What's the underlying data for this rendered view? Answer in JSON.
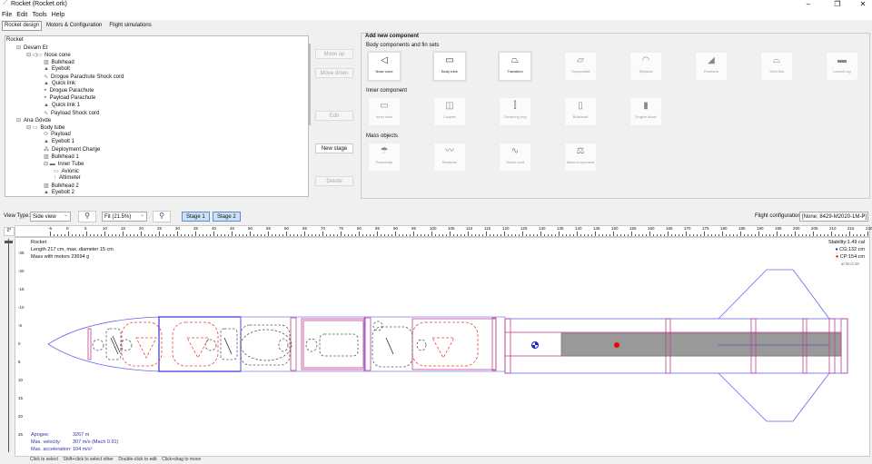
{
  "window": {
    "title": "Rocket (Rocket.ork)",
    "minimize": "–",
    "maximize": "❐",
    "close": "✕"
  },
  "menu": [
    "File",
    "Edit",
    "Tools",
    "Help"
  ],
  "tabs": [
    "Rocket design",
    "Motors & Configuration",
    "Flight simulations"
  ],
  "tree": [
    {
      "label": "Rocket",
      "depth": 0,
      "icon": ""
    },
    {
      "label": "Devam Et",
      "depth": 1,
      "icon": "⊟"
    },
    {
      "label": "Nose cone",
      "depth": 2,
      "icon": "⊟ ◁▭"
    },
    {
      "label": "Bulkhead",
      "depth": 3,
      "icon": "▥"
    },
    {
      "label": "Eyebolt",
      "depth": 3,
      "icon": "▲"
    },
    {
      "label": "Drogue Parachute Shock cord",
      "depth": 3,
      "icon": "∿"
    },
    {
      "label": "Quick link",
      "depth": 3,
      "icon": "▲"
    },
    {
      "label": "Drogue Parachute",
      "depth": 3,
      "icon": "◓"
    },
    {
      "label": "Payload Parachute",
      "depth": 3,
      "icon": "◓"
    },
    {
      "label": "Quick link 1",
      "depth": 3,
      "icon": "▲"
    },
    {
      "label": "Payload Shock cord",
      "depth": 3,
      "icon": "∿"
    },
    {
      "label": "Ana Gövde",
      "depth": 1,
      "icon": "⊟"
    },
    {
      "label": "Body tube",
      "depth": 2,
      "icon": "⊟ ▭"
    },
    {
      "label": "Payload",
      "depth": 3,
      "icon": "⬭"
    },
    {
      "label": "Eyebolt 1",
      "depth": 3,
      "icon": "▲"
    },
    {
      "label": "Deployment Charge",
      "depth": 3,
      "icon": "⁂"
    },
    {
      "label": "Bulkhead 1",
      "depth": 3,
      "icon": "▥"
    },
    {
      "label": "Inner Tube",
      "depth": 3,
      "icon": "⊟ ▬"
    },
    {
      "label": "Avionic",
      "depth": 4,
      "icon": "▭"
    },
    {
      "label": "Altimeter",
      "depth": 4,
      "icon": "↑"
    },
    {
      "label": "Bulkhead 2",
      "depth": 3,
      "icon": "▥"
    },
    {
      "label": "Eyebolt 2",
      "depth": 3,
      "icon": "▲"
    }
  ],
  "buttons": {
    "move_up": "Move up",
    "move_down": "Move down",
    "edit": "Edit",
    "new_stage": "New stage",
    "delete": "Delete"
  },
  "add": {
    "title": "Add new component",
    "sections": [
      {
        "label": "Body components and fin sets",
        "items": [
          {
            "label": "Nose cone",
            "icon": "◁",
            "en": true
          },
          {
            "label": "Body tube",
            "icon": "▭",
            "en": true
          },
          {
            "label": "Transition",
            "icon": "⏢",
            "en": true
          },
          {
            "label": "Trapezoidal",
            "icon": "⏥",
            "en": false
          },
          {
            "label": "Elliptical",
            "icon": "◠",
            "en": false
          },
          {
            "label": "Freeform",
            "icon": "◢",
            "en": false
          },
          {
            "label": "Tube fins",
            "icon": "⌓",
            "en": false
          },
          {
            "label": "Launch lug",
            "icon": "▬",
            "en": false
          }
        ]
      },
      {
        "label": "Inner component",
        "items": [
          {
            "label": "Inner tube",
            "icon": "▭",
            "en": false
          },
          {
            "label": "Coupler",
            "icon": "◫",
            "en": false
          },
          {
            "label": "Centering ring",
            "icon": "⫿",
            "en": false
          },
          {
            "label": "Bulkhead",
            "icon": "▯",
            "en": false
          },
          {
            "label": "Engine block",
            "icon": "▮",
            "en": false
          }
        ]
      },
      {
        "label": "Mass objects",
        "items": [
          {
            "label": "Parachute",
            "icon": "☂",
            "en": false
          },
          {
            "label": "Streamer",
            "icon": "〰",
            "en": false
          },
          {
            "label": "Shock cord",
            "icon": "∿",
            "en": false
          },
          {
            "label": "Mass component",
            "icon": "⚖",
            "en": false
          }
        ]
      }
    ]
  },
  "view": {
    "type_label": "View Type:",
    "type_value": "Side view",
    "zoom_value": "Fit (21.5%)",
    "stages": [
      "Stage 1",
      "Stage 2"
    ],
    "config_label": "Flight configuration:",
    "config_value": "[None; 8429-M2020-1M-P]",
    "rotation": "0°"
  },
  "ruler_h": [
    -5,
    0,
    5,
    10,
    15,
    20,
    25,
    30,
    35,
    40,
    45,
    50,
    55,
    60,
    65,
    70,
    75,
    80,
    85,
    90,
    95,
    100,
    105,
    110,
    115,
    120,
    125,
    130,
    135,
    140,
    145,
    150,
    155,
    160,
    165,
    170,
    175,
    180,
    185,
    190,
    195,
    200,
    205,
    210,
    215,
    220
  ],
  "ruler_v": [
    -25,
    -20,
    -15,
    -10,
    -5,
    0,
    5,
    10,
    15,
    20,
    25
  ],
  "rocket": {
    "name": "Rocket",
    "length": "Length 217 cm, max. diameter 15 cm",
    "mass": "Mass with motors 23694 g",
    "stability": "Stability:1.49 cal",
    "cg": "CG:132 cm",
    "cp": "CP:154 cm",
    "mach": "at M=0.30"
  },
  "flight": {
    "apogee_label": "Apogee:",
    "apogee": "3267 m",
    "vel_label": "Max. velocity:",
    "vel": "307 m/s  (Mach 0.91)",
    "acc_label": "Max. acceleration:",
    "acc": "104 m/s²"
  },
  "status": "Click to select    Shift+click to select other    Double-click to edit    Click+drag to move"
}
